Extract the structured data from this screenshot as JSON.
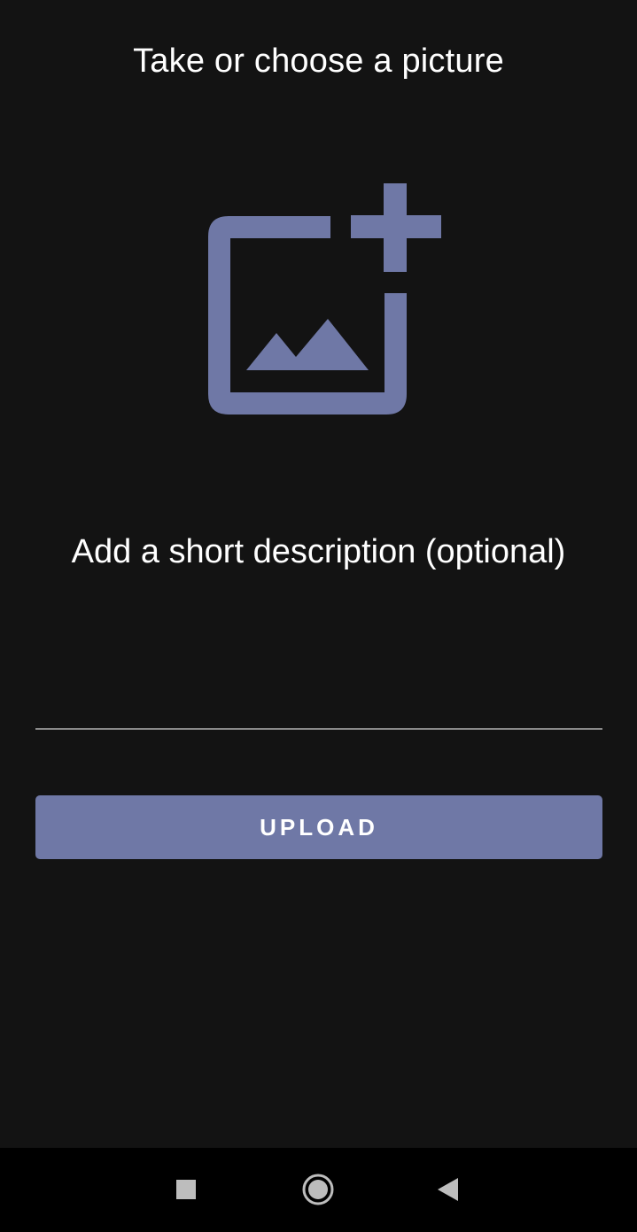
{
  "page": {
    "title": "Take or choose a picture",
    "description_label": "Add a short description (optional)"
  },
  "image_picker": {
    "icon": "add-photo-icon",
    "color": "#6f78a6"
  },
  "description_input": {
    "value": "",
    "placeholder": ""
  },
  "upload_button": {
    "label": "UPLOAD",
    "color": "#6f78a6"
  },
  "navigation_bar": {
    "buttons": [
      {
        "icon": "recents-square-icon"
      },
      {
        "icon": "home-circle-icon"
      },
      {
        "icon": "back-triangle-icon"
      }
    ]
  },
  "colors": {
    "background": "#131313",
    "accent": "#6f78a6",
    "text": "#ffffff"
  }
}
